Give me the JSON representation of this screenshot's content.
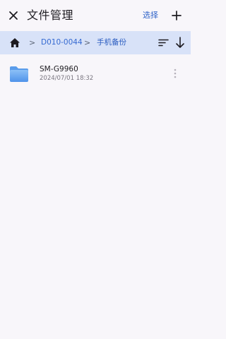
{
  "header": {
    "title": "文件管理",
    "select_label": "选择",
    "close_icon": "close-icon",
    "add_icon": "plus-icon"
  },
  "breadcrumb": {
    "home_icon": "home-icon",
    "separator": ">",
    "items": [
      {
        "label": "D010-0044"
      },
      {
        "label": "手机备份"
      }
    ],
    "sort_icon": "sort-lines-icon",
    "order_icon": "arrow-down-icon"
  },
  "files": [
    {
      "name": "SM-G9960",
      "date": "2024/07/01 18:32",
      "icon": "folder-icon",
      "more_icon": "more-vertical-icon"
    }
  ],
  "colors": {
    "background": "#f8f6fa",
    "breadcrumb_bar": "#d8e2f8",
    "accent": "#2f63c8",
    "folder": "#6aa8ef"
  }
}
